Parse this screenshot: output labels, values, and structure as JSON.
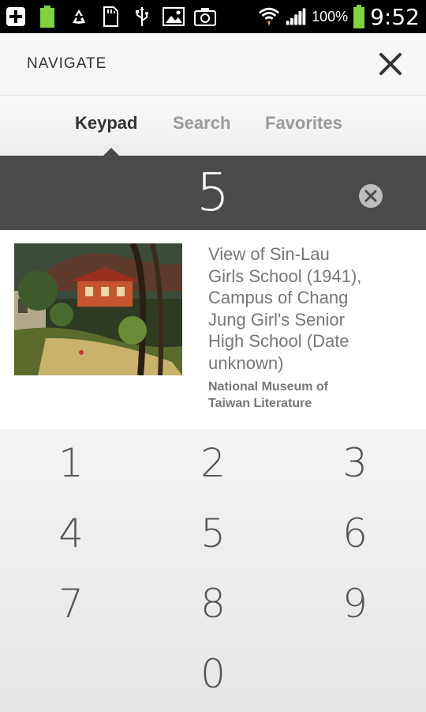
{
  "statusbar": {
    "battery_small_label": "100%",
    "battery_pct": "100%",
    "time": "9:52"
  },
  "header": {
    "title": "NAVIGATE"
  },
  "tabs": [
    {
      "label": "Keypad",
      "active": true
    },
    {
      "label": "Search",
      "active": false
    },
    {
      "label": "Favorites",
      "active": false
    }
  ],
  "display": {
    "value": "5"
  },
  "result": {
    "title_lines": [
      "View of Sin-Lau",
      "Girls School (1941),",
      "Campus of Chang",
      "Jung Girl's Senior",
      "High School (Date",
      "unknown)"
    ],
    "sub_lines": [
      "National Museum of",
      "Taiwan Literature"
    ]
  },
  "keypad": {
    "keys": [
      "1",
      "2",
      "3",
      "4",
      "5",
      "6",
      "7",
      "8",
      "9",
      "0"
    ]
  },
  "colors": {
    "display_bg": "#4a4a4a",
    "active_tab": "#333333",
    "inactive_tab": "#9a9a9a",
    "battery_green": "#7fd33b"
  }
}
